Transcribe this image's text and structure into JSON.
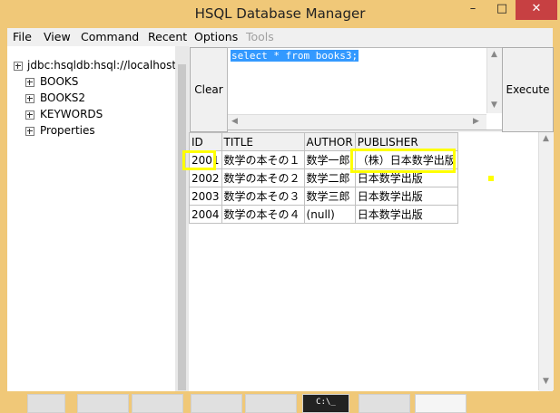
{
  "window": {
    "title": "HSQL Database Manager",
    "controls": {
      "minimize": "–",
      "maximize": "□",
      "close": "✕"
    }
  },
  "menu": [
    "File",
    "View",
    "Command",
    "Recent",
    "Options",
    "Tools"
  ],
  "tree": {
    "root": "jdbc:hsqldb:hsql://localhost/",
    "items": [
      "BOOKS",
      "BOOKS2",
      "KEYWORDS",
      "Properties"
    ]
  },
  "buttons": {
    "clear": "Clear",
    "execute": "Execute"
  },
  "editor": {
    "sql": "select * from books3;"
  },
  "results": {
    "headers": [
      "ID",
      "TITLE",
      "AUTHOR",
      "PUBLISHER"
    ],
    "rows": [
      [
        "2001",
        "数学の本その１",
        "数学一郎",
        "（株）日本数学出版"
      ],
      [
        "2002",
        "数学の本その２",
        "数学二郎",
        "日本数学出版"
      ],
      [
        "2003",
        "数学の本その３",
        "数学三郎",
        "日本数学出版"
      ],
      [
        "2004",
        "数学の本その４",
        "(null)",
        "日本数学出版"
      ]
    ]
  },
  "scroll": {
    "up": "▲",
    "down": "▼",
    "left": "◀",
    "right": "▶"
  },
  "taskbar": {
    "cmd_label": "C:\\_"
  },
  "colors": {
    "highlight": "#ffff00",
    "selection": "#3399ff",
    "titlebar": "#f0c878",
    "close": "#c74042"
  }
}
